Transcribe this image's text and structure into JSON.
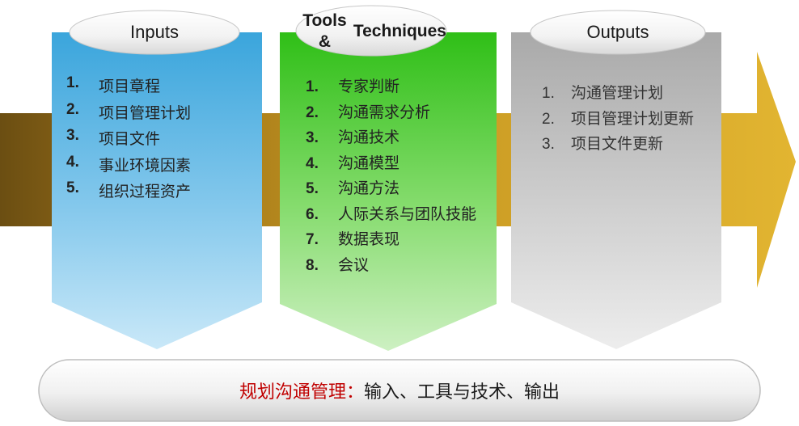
{
  "columns": [
    {
      "title": "Inputs"
    },
    {
      "title_lines": [
        "Tools &",
        "Techniques"
      ]
    },
    {
      "title": "Outputs"
    }
  ],
  "inputs": {
    "items": [
      {
        "num": "1.",
        "text": "项目章程"
      },
      {
        "num": "2.",
        "text": "项目管理计划"
      },
      {
        "num": "3.",
        "text": "项目文件"
      },
      {
        "num": "4.",
        "text": "事业环境因素"
      },
      {
        "num": "5.",
        "text": "组织过程资产"
      }
    ]
  },
  "tools": {
    "items": [
      {
        "num": "1.",
        "text": "专家判断"
      },
      {
        "num": "2.",
        "text": "沟通需求分析"
      },
      {
        "num": "3.",
        "text": "沟通技术"
      },
      {
        "num": "4.",
        "text": "沟通模型"
      },
      {
        "num": "5.",
        "text": "沟通方法"
      },
      {
        "num": "6.",
        "text": "人际关系与团队技能"
      },
      {
        "num": "7.",
        "text": "数据表现"
      },
      {
        "num": "8.",
        "text": "会议"
      }
    ]
  },
  "outputs": {
    "items": [
      {
        "num": "1.",
        "text": "沟通管理计划"
      },
      {
        "num": "2.",
        "text": "项目管理计划更新"
      },
      {
        "num": "3.",
        "text": "项目文件更新"
      }
    ]
  },
  "banner": {
    "highlight": "规划沟通管理：",
    "rest": "输入、工具与技术、输出"
  },
  "colors": {
    "arrow_gold": "#d9a92a",
    "arrow_dark_brown": "#6b4e12",
    "inputs_blue": "#3aa5dc",
    "tools_green": "#33c01a",
    "outputs_gray": "#b4b4b4",
    "banner_highlight": "#c00000"
  }
}
